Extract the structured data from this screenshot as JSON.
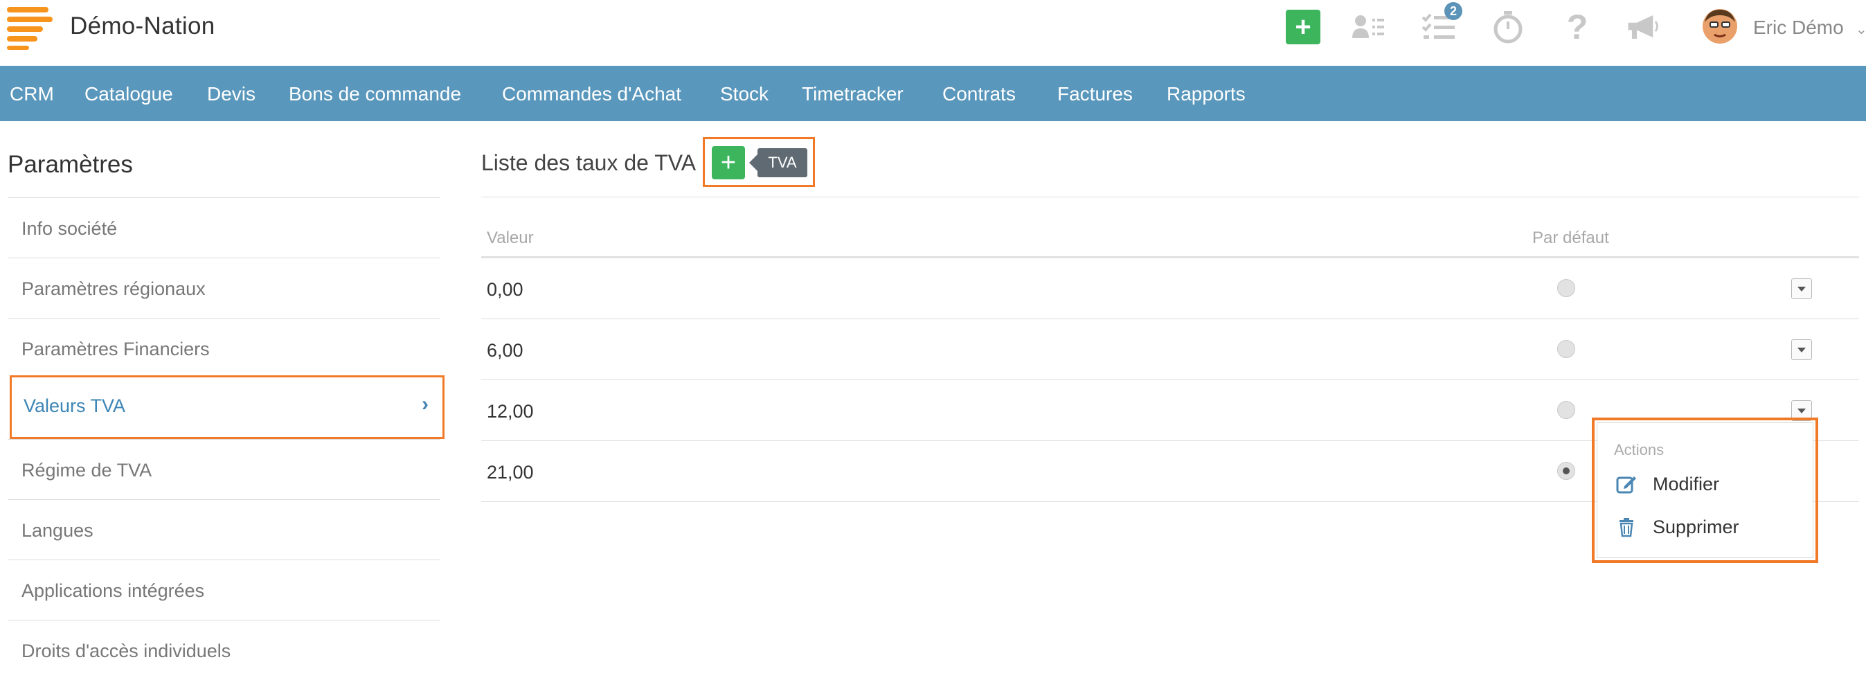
{
  "app": {
    "title": "Démo-Nation",
    "brand_color": "#f7941d"
  },
  "topbar": {
    "add_icon": "plus-icon",
    "contacts_icon": "contact-list-icon",
    "tasks_icon": "task-list-icon",
    "tasks_badge": "2",
    "timer_icon": "stopwatch-icon",
    "help_icon": "question-icon",
    "announce_icon": "megaphone-icon",
    "user": {
      "name": "Eric Démo",
      "avatar_icon": "avatar"
    }
  },
  "nav": {
    "items": [
      "CRM",
      "Catalogue",
      "Devis",
      "Bons de commande",
      "Commandes d'Achat",
      "Stock",
      "Timetracker",
      "Contrats",
      "Factures",
      "Rapports"
    ],
    "bg_color": "#5a97bc"
  },
  "sidebar": {
    "title": "Paramètres",
    "items": [
      {
        "label": "Info société"
      },
      {
        "label": "Paramètres régionaux"
      },
      {
        "label": "Paramètres Financiers"
      },
      {
        "label": "Valeurs TVA",
        "active": true
      },
      {
        "label": "Régime de TVA"
      },
      {
        "label": "Langues"
      },
      {
        "label": "Applications intégrées"
      },
      {
        "label": "Droits d'accès individuels"
      }
    ]
  },
  "content": {
    "title": "Liste des taux de TVA",
    "add_tooltip": "TVA",
    "columns": {
      "value": "Valeur",
      "default": "Par défaut"
    },
    "rows": [
      {
        "value": "0,00",
        "default": false
      },
      {
        "value": "6,00",
        "default": false
      },
      {
        "value": "12,00",
        "default": false
      },
      {
        "value": "21,00",
        "default": true
      }
    ]
  },
  "actions_menu": {
    "header": "Actions",
    "items": [
      {
        "label": "Modifier",
        "icon": "edit-icon"
      },
      {
        "label": "Supprimer",
        "icon": "trash-icon"
      }
    ]
  },
  "highlight_color": "#f07a28",
  "accent_green": "#3cb55d"
}
